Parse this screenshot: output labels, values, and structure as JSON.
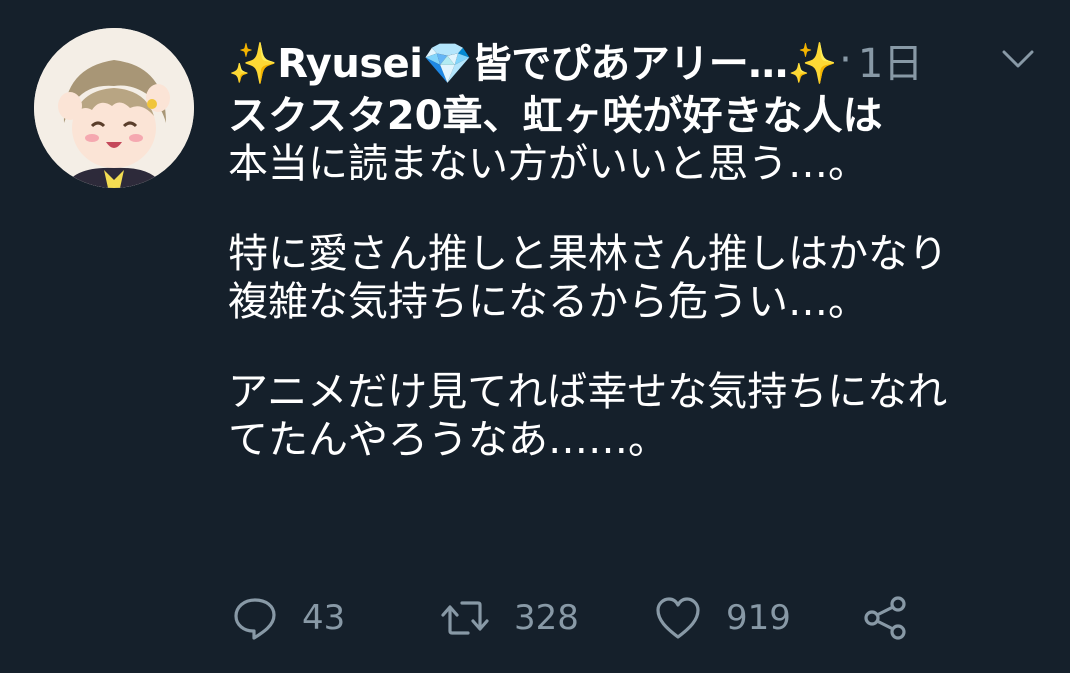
{
  "tweet": {
    "display_name": "✨Ryusei💎皆でぴあアリー…✨",
    "separator": "·",
    "timestamp": "1日",
    "text_lines": [
      "スクスタ20章、虹ヶ咲が好きな人は",
      "本当に読まない方がいいと思う…。",
      "特に愛さん推しと果林さん推しはかなり",
      "複雑な気持ちになるから危うい…。",
      "アニメだけ見てれば幸せな気持ちになれ",
      "てたんやろうなあ……。"
    ],
    "reply_count": "43",
    "retweet_count": "328",
    "like_count": "919"
  },
  "icons": {
    "more": "chevron-down-icon",
    "reply": "reply-icon",
    "retweet": "retweet-icon",
    "like": "heart-icon",
    "share": "share-icon"
  },
  "colors": {
    "background": "#15202b",
    "text": "#ffffff",
    "secondary": "#8899a6"
  }
}
